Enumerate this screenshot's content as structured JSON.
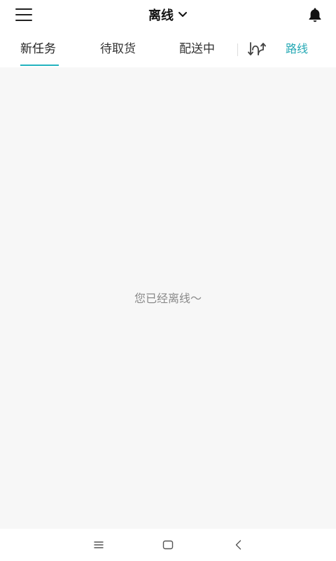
{
  "header": {
    "status_label": "离线",
    "icons": {
      "menu": "hamburger-menu-icon",
      "dropdown": "chevron-down-icon",
      "notifications": "bell-icon"
    }
  },
  "tabs": [
    {
      "label": "新任务",
      "active": true
    },
    {
      "label": "待取货",
      "active": false
    },
    {
      "label": "配送中",
      "active": false
    }
  ],
  "route": {
    "label": "路线",
    "icon": "sort-arrows-icon"
  },
  "main": {
    "empty_message": "您已经离线～"
  },
  "colors": {
    "accent": "#23b3bf",
    "content_bg": "#f7f7f7"
  },
  "system_nav": {
    "icons": [
      "recent-apps-icon",
      "home-icon",
      "back-icon"
    ]
  }
}
